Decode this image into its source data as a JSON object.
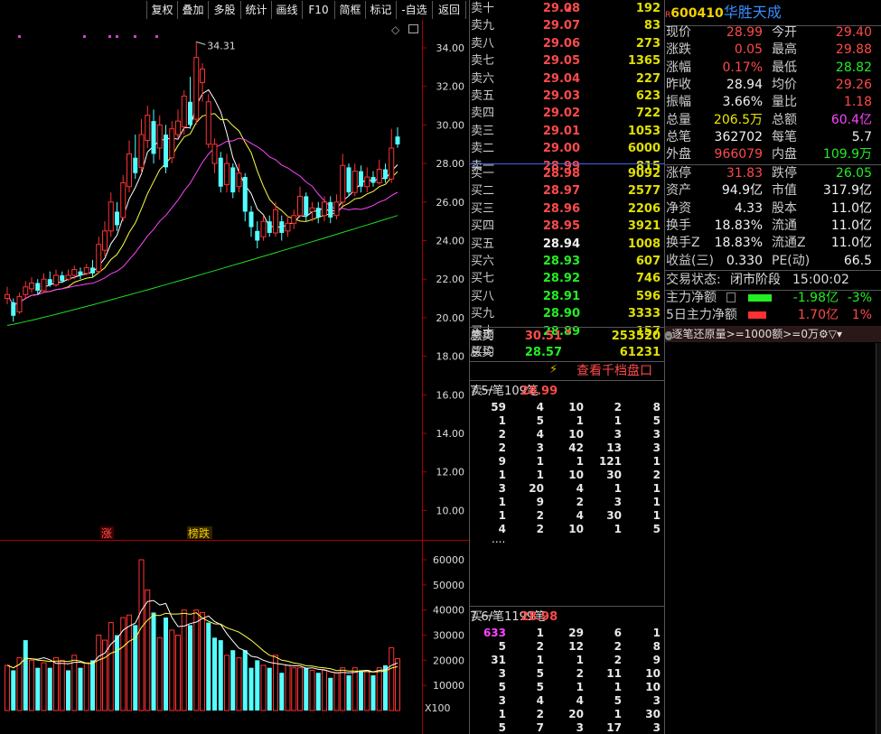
{
  "toolbar": {
    "buttons": [
      "复权",
      "叠加",
      "多股",
      "统计",
      "画线",
      "F10",
      "简框",
      "标记",
      "-自选",
      "返回"
    ]
  },
  "kline": {
    "y_axis_ticks": [
      "34.00",
      "32.00",
      "30.00",
      "28.00",
      "26.00",
      "24.00",
      "22.00",
      "20.00",
      "18.00",
      "16.00",
      "14.00",
      "12.00",
      "10.00"
    ],
    "high_label": "34.31",
    "markers": [
      "涨",
      "榜跌"
    ]
  },
  "volume": {
    "y_axis_ticks": [
      "60000",
      "50000",
      "40000",
      "30000",
      "20000",
      "10000"
    ],
    "unit": "X100"
  },
  "chart_data": {
    "type": "candlestick",
    "price_ylim": [
      8.5,
      35.5
    ],
    "volume_ylim": [
      0,
      68000
    ],
    "candles": [
      [
        21.0,
        21.2,
        21.6,
        20.7
      ],
      [
        20.8,
        20.1,
        21.0,
        19.8
      ],
      [
        20.3,
        21.1,
        21.3,
        20.2
      ],
      [
        21.2,
        21.6,
        21.9,
        21.0
      ],
      [
        21.5,
        21.8,
        22.1,
        21.3
      ],
      [
        21.8,
        21.4,
        22.0,
        21.2
      ],
      [
        21.4,
        22.0,
        22.3,
        21.3
      ],
      [
        22.0,
        21.7,
        22.4,
        21.6
      ],
      [
        21.7,
        22.2,
        22.5,
        21.6
      ],
      [
        22.2,
        21.9,
        22.4,
        21.8
      ],
      [
        22.0,
        22.2,
        22.5,
        21.9
      ],
      [
        22.2,
        22.5,
        22.7,
        22.0
      ],
      [
        22.4,
        22.2,
        22.6,
        22.0
      ],
      [
        22.3,
        22.6,
        22.8,
        22.2
      ],
      [
        22.6,
        22.3,
        23.0,
        22.1
      ],
      [
        22.4,
        23.8,
        24.2,
        22.3
      ],
      [
        23.5,
        24.5,
        25.0,
        23.2
      ],
      [
        24.5,
        26.0,
        26.5,
        24.2
      ],
      [
        25.5,
        24.8,
        26.0,
        24.5
      ],
      [
        25.2,
        27.0,
        27.4,
        25.0
      ],
      [
        26.8,
        28.5,
        29.2,
        26.5
      ],
      [
        28.3,
        27.5,
        29.5,
        27.2
      ],
      [
        27.8,
        29.5,
        30.3,
        27.5
      ],
      [
        29.2,
        30.5,
        31.0,
        28.8
      ],
      [
        30.2,
        28.5,
        30.8,
        28.0
      ],
      [
        28.8,
        30.0,
        30.5,
        28.2
      ],
      [
        29.5,
        27.8,
        30.0,
        27.5
      ],
      [
        28.3,
        29.8,
        30.2,
        28.0
      ],
      [
        29.5,
        30.2,
        30.8,
        29.3
      ],
      [
        29.9,
        31.5,
        31.8,
        29.5
      ],
      [
        31.2,
        30.0,
        32.5,
        29.8
      ],
      [
        30.3,
        33.5,
        34.31,
        30.0
      ],
      [
        32.2,
        32.9,
        33.2,
        31.2
      ],
      [
        29.0,
        31.2,
        31.6,
        28.8
      ],
      [
        28.0,
        29.0,
        29.3,
        27.5
      ],
      [
        28.3,
        26.8,
        28.6,
        26.5
      ],
      [
        26.9,
        28.0,
        28.5,
        26.5
      ],
      [
        27.8,
        26.5,
        28.0,
        26.2
      ],
      [
        26.8,
        27.5,
        28.0,
        26.5
      ],
      [
        27.3,
        25.5,
        27.5,
        25.0
      ],
      [
        25.5,
        24.7,
        25.8,
        24.2
      ],
      [
        24.5,
        24.0,
        25.0,
        23.6
      ],
      [
        24.2,
        25.0,
        25.3,
        24.0
      ],
      [
        25.0,
        24.4,
        25.3,
        24.2
      ],
      [
        24.4,
        25.6,
        26.0,
        24.2
      ],
      [
        25.0,
        24.4,
        25.3,
        24.0
      ],
      [
        24.5,
        24.9,
        25.3,
        24.2
      ],
      [
        24.9,
        25.3,
        25.6,
        24.6
      ],
      [
        25.3,
        26.3,
        26.8,
        25.2
      ],
      [
        26.3,
        25.3,
        26.5,
        25.0
      ],
      [
        25.5,
        25.7,
        26.0,
        25.0
      ],
      [
        25.7,
        25.2,
        26.0,
        24.9
      ],
      [
        25.3,
        26.0,
        26.3,
        25.0
      ],
      [
        26.0,
        25.2,
        26.3,
        24.9
      ],
      [
        25.3,
        26.0,
        26.4,
        25.1
      ],
      [
        26.0,
        27.9,
        28.5,
        25.8
      ],
      [
        27.8,
        26.5,
        28.0,
        26.3
      ],
      [
        26.5,
        27.6,
        28.0,
        26.3
      ],
      [
        27.6,
        26.8,
        27.9,
        26.5
      ],
      [
        26.8,
        27.3,
        27.8,
        26.5
      ],
      [
        27.3,
        27.0,
        27.6,
        26.8
      ],
      [
        27.0,
        27.7,
        28.2,
        26.9
      ],
      [
        27.7,
        27.2,
        28.0,
        27.0
      ],
      [
        27.2,
        28.8,
        29.8,
        27.0
      ],
      [
        29.4,
        28.99,
        29.88,
        28.82
      ]
    ],
    "volumes": [
      [
        18000,
        1
      ],
      [
        16000,
        0
      ],
      [
        21000,
        1
      ],
      [
        28000,
        0
      ],
      [
        20000,
        1
      ],
      [
        17000,
        0
      ],
      [
        19000,
        1
      ],
      [
        17000,
        0
      ],
      [
        21000,
        1
      ],
      [
        20000,
        1
      ],
      [
        16000,
        0
      ],
      [
        22000,
        1
      ],
      [
        17000,
        0
      ],
      [
        19000,
        1
      ],
      [
        20000,
        0
      ],
      [
        30000,
        1
      ],
      [
        28000,
        1
      ],
      [
        35000,
        1
      ],
      [
        30000,
        0
      ],
      [
        37000,
        1
      ],
      [
        38000,
        1
      ],
      [
        34000,
        0
      ],
      [
        60000,
        1
      ],
      [
        48000,
        1
      ],
      [
        39000,
        0
      ],
      [
        29000,
        1
      ],
      [
        37000,
        0
      ],
      [
        32000,
        1
      ],
      [
        30000,
        1
      ],
      [
        40000,
        1
      ],
      [
        34000,
        0
      ],
      [
        40000,
        1
      ],
      [
        39000,
        1
      ],
      [
        35000,
        0
      ],
      [
        29000,
        0
      ],
      [
        28000,
        0
      ],
      [
        22000,
        1
      ],
      [
        24000,
        0
      ],
      [
        21000,
        1
      ],
      [
        24000,
        0
      ],
      [
        17000,
        0
      ],
      [
        20000,
        0
      ],
      [
        18000,
        1
      ],
      [
        17000,
        0
      ],
      [
        22000,
        1
      ],
      [
        15000,
        0
      ],
      [
        18000,
        1
      ],
      [
        17000,
        1
      ],
      [
        17000,
        1
      ],
      [
        17000,
        0
      ],
      [
        16000,
        1
      ],
      [
        15000,
        0
      ],
      [
        16000,
        1
      ],
      [
        13000,
        0
      ],
      [
        15000,
        1
      ],
      [
        17000,
        1
      ],
      [
        14000,
        0
      ],
      [
        17000,
        1
      ],
      [
        16000,
        0
      ],
      [
        16000,
        1
      ],
      [
        14000,
        0
      ],
      [
        17000,
        1
      ],
      [
        18000,
        0
      ],
      [
        25000,
        1
      ],
      [
        20655,
        1
      ]
    ]
  },
  "orderbook": {
    "asks": [
      {
        "label": "卖十",
        "price": "29.08",
        "arrow": "up",
        "volume": "192"
      },
      {
        "label": "卖九",
        "price": "29.07",
        "volume": "83"
      },
      {
        "label": "卖八",
        "price": "29.06",
        "volume": "273"
      },
      {
        "label": "卖七",
        "price": "29.05",
        "volume": "1365"
      },
      {
        "label": "卖六",
        "price": "29.04",
        "volume": "227"
      },
      {
        "label": "卖五",
        "price": "29.03",
        "volume": "623"
      },
      {
        "label": "卖四",
        "price": "29.02",
        "volume": "722"
      },
      {
        "label": "卖三",
        "price": "29.01",
        "volume": "1053"
      },
      {
        "label": "卖二",
        "price": "29.00",
        "volume": "6000"
      },
      {
        "label": "卖一",
        "price": "28.99",
        "volume": "815"
      }
    ],
    "bids": [
      {
        "label": "买一",
        "price": "28.98",
        "volume": "9092"
      },
      {
        "label": "买二",
        "price": "28.97",
        "volume": "2577"
      },
      {
        "label": "买三",
        "price": "28.96",
        "volume": "2206"
      },
      {
        "label": "买四",
        "price": "28.95",
        "volume": "3921"
      },
      {
        "label": "买五",
        "price": "28.94",
        "volume": "1008"
      },
      {
        "label": "买六",
        "price": "28.93",
        "volume": "607"
      },
      {
        "label": "买七",
        "price": "28.92",
        "volume": "746"
      },
      {
        "label": "买八",
        "price": "28.91",
        "volume": "596"
      },
      {
        "label": "买九",
        "price": "28.90",
        "volume": "3333"
      },
      {
        "label": "买十",
        "price": "28.89",
        "arrow": "down",
        "volume": "157"
      }
    ],
    "ask_avg": {
      "label": "卖均",
      "price": "30.51",
      "total_label": "总卖",
      "total": "253520"
    },
    "bid_avg": {
      "label": "买均",
      "price": "28.57",
      "total_label": "总买",
      "total": "61231"
    },
    "qiandang_button": "查看千档盘口",
    "sell_queue": {
      "label": "卖一",
      "price": "28.99",
      "avg": "7.5/笔",
      "count": "109笔",
      "rows": [
        [
          "59",
          "4",
          "10",
          "2",
          "8"
        ],
        [
          "1",
          "5",
          "1",
          "1",
          "5"
        ],
        [
          "2",
          "4",
          "10",
          "3",
          "3"
        ],
        [
          "2",
          "3",
          "42",
          "13",
          "3"
        ],
        [
          "9",
          "1",
          "1",
          "121",
          "1"
        ],
        [
          "1",
          "1",
          "10",
          "30",
          "2"
        ],
        [
          "3",
          "20",
          "4",
          "1",
          "1"
        ],
        [
          "1",
          "9",
          "2",
          "3",
          "1"
        ],
        [
          "1",
          "2",
          "4",
          "30",
          "1"
        ],
        [
          "4",
          "2",
          "10",
          "1",
          "5"
        ]
      ],
      "more": "...."
    },
    "buy_queue": {
      "label": "买一",
      "price": "28.98",
      "avg": "7.6/笔",
      "count": "1199笔",
      "rows": [
        [
          "633",
          "1",
          "29",
          "6",
          "1"
        ],
        [
          "5",
          "2",
          "12",
          "2",
          "8"
        ],
        [
          "31",
          "1",
          "1",
          "2",
          "9"
        ],
        [
          "3",
          "5",
          "2",
          "11",
          "10"
        ],
        [
          "5",
          "5",
          "1",
          "1",
          "10"
        ],
        [
          "3",
          "4",
          "4",
          "5",
          "3"
        ],
        [
          "1",
          "2",
          "20",
          "1",
          "30"
        ],
        [
          "5",
          "7",
          "3",
          "17",
          "3"
        ]
      ]
    }
  },
  "stock": {
    "badge": "R",
    "code": "600410",
    "name": "华胜天成",
    "fields": [
      {
        "l1": "现价",
        "v1": "28.99",
        "c1": "red",
        "l2": "今开",
        "v2": "29.40",
        "c2": "red"
      },
      {
        "l1": "涨跌",
        "v1": "0.05",
        "c1": "red",
        "l2": "最高",
        "v2": "29.88",
        "c2": "red"
      },
      {
        "l1": "涨幅",
        "v1": "0.17%",
        "c1": "red",
        "l2": "最低",
        "v2": "28.82",
        "c2": "green"
      },
      {
        "l1": "昨收",
        "v1": "28.94",
        "c1": "white",
        "l2": "均价",
        "v2": "29.26",
        "c2": "red"
      },
      {
        "l1": "振幅",
        "v1": "3.66%",
        "c1": "white",
        "l2": "量比",
        "v2": "1.18",
        "c2": "red"
      },
      {
        "l1": "总量",
        "v1": "206.5万",
        "c1": "yellow",
        "l2": "总额",
        "v2": "60.4亿",
        "c2": "magenta"
      },
      {
        "l1": "总笔",
        "v1": "362702",
        "c1": "white",
        "l2": "每笔",
        "v2": "5.7",
        "c2": "white"
      },
      {
        "l1": "外盘",
        "v1": "966079",
        "c1": "red",
        "l2": "内盘",
        "v2": "109.9万",
        "c2": "green"
      }
    ],
    "fields2": [
      {
        "l1": "涨停",
        "v1": "31.83",
        "c1": "red",
        "l2": "跌停",
        "v2": "26.05",
        "c2": "green"
      },
      {
        "l1": "资产",
        "v1": "94.9亿",
        "c1": "white",
        "l2": "市值",
        "v2": "317.9亿",
        "c2": "white"
      },
      {
        "l1": "净资",
        "v1": "4.33",
        "c1": "white",
        "l2": "股本",
        "v2": "11.0亿",
        "c2": "white"
      },
      {
        "l1": "换手",
        "v1": "18.83%",
        "c1": "white",
        "l2": "流通",
        "v2": "11.0亿",
        "c2": "white"
      },
      {
        "l1": "换手Z",
        "v1": "18.83%",
        "c1": "white",
        "l2": "流通Z",
        "v2": "11.0亿",
        "c2": "white"
      },
      {
        "l1": "收益(三)",
        "v1": "0.330",
        "c1": "white",
        "l2": "PE(动)",
        "v2": "66.5",
        "c2": "white"
      }
    ],
    "status_label": "交易状态:",
    "status": "闭市阶段",
    "time": "15:00:02",
    "main_flow": {
      "label": "主力净额",
      "value": "-1.98亿",
      "pct": "-3%"
    },
    "flow5": {
      "label": "5日主力净额",
      "value": "1.70亿",
      "pct": "1%"
    },
    "filter_bar": {
      "label": "逐笔还原",
      "opt1": "量>=1000",
      "opt2": "额>=0万"
    }
  },
  "colors": {
    "up": "#ff3232",
    "down": "#54ffff",
    "ma5": "#ffffff",
    "ma10": "#ffff44",
    "ma20": "#ff44ff",
    "ma60": "#22dd22"
  }
}
